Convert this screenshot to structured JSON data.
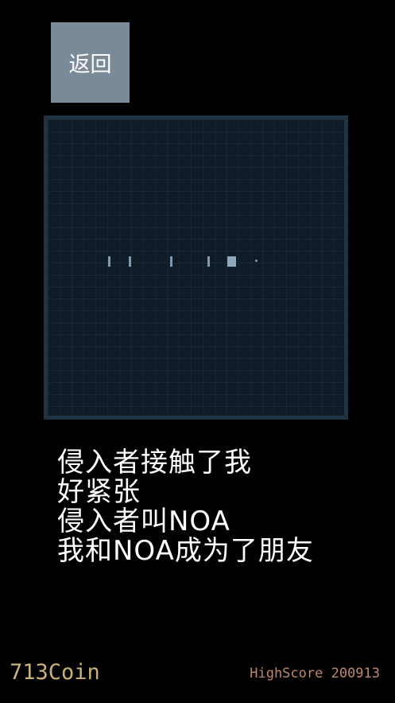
{
  "header": {
    "back_label": "返回"
  },
  "board": {
    "pieces": [
      "bar",
      "bar",
      "bar",
      "bar",
      "block",
      "dot"
    ]
  },
  "story": {
    "lines": [
      "侵入者接触了我",
      "好紧张",
      "侵入者叫NOA",
      "我和NOA成为了朋友"
    ]
  },
  "footer": {
    "coins": "713Coin",
    "high_score": "HighScore 200913"
  },
  "colors": {
    "background": "#000000",
    "back_button": "#7a8a99",
    "board_border": "#1f3340",
    "board_fill": "#0f1b26",
    "coin_text": "#c9b27a",
    "high_score_text": "#c1866a"
  }
}
